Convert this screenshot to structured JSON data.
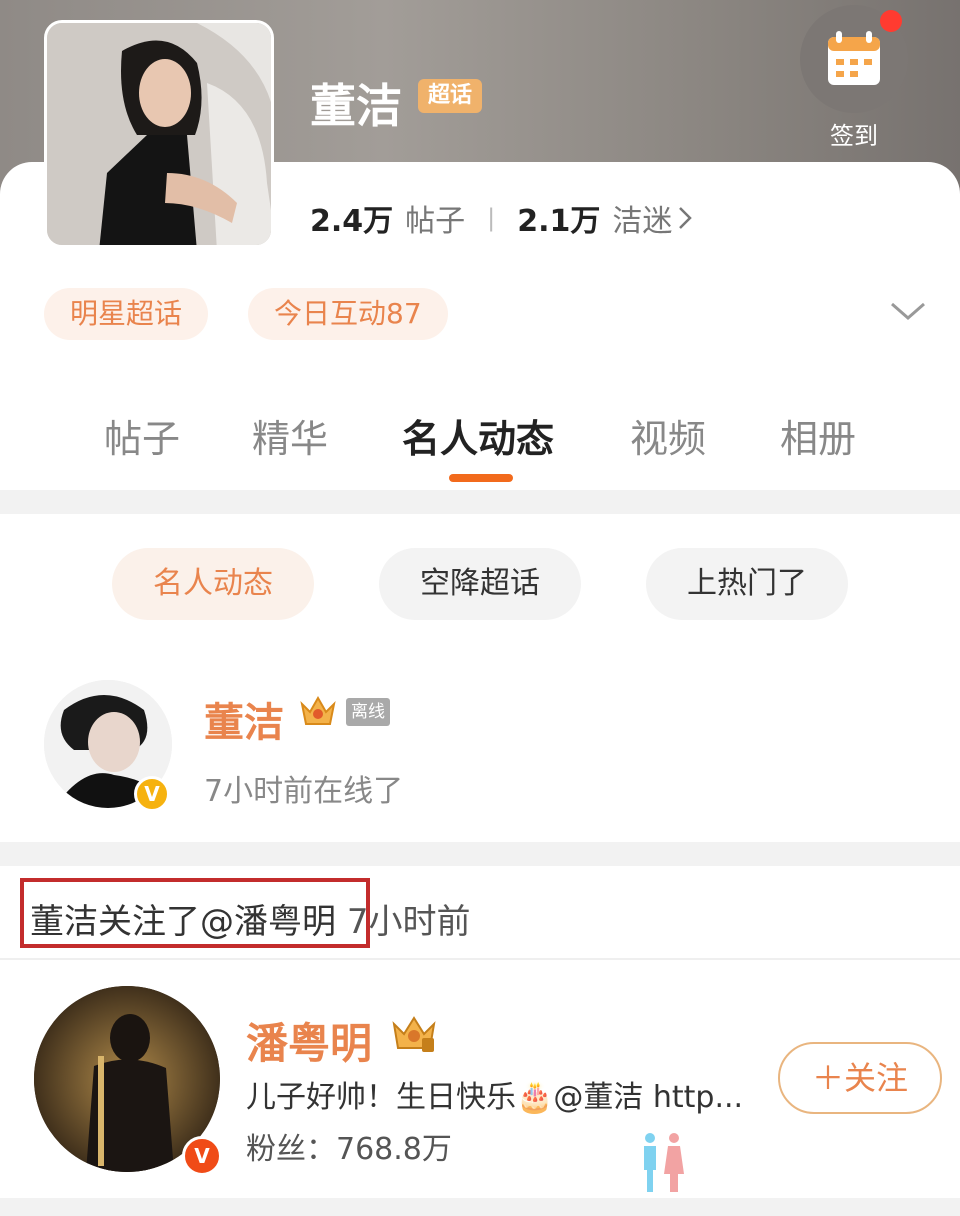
{
  "topic": {
    "title": "董洁",
    "tag": "超话",
    "checkin_label": "签到",
    "posts_count": "2.4万",
    "posts_label": "帖子",
    "fans_count": "2.1万",
    "fans_label": "洁迷",
    "chips": [
      "明星超话",
      "今日互动87"
    ]
  },
  "tabs": [
    "帖子",
    "精华",
    "名人动态",
    "视频",
    "相册"
  ],
  "active_tab": "名人动态",
  "filters": [
    "名人动态",
    "空降超话",
    "上热门了"
  ],
  "celebrity": {
    "name": "董洁",
    "status_badge": "离线",
    "online_text": "7小时前在线了"
  },
  "activity": {
    "text": "董洁关注了@潘粤明",
    "time": "7小时前"
  },
  "followed_user": {
    "name": "潘粤明",
    "post_preview": "儿子好帅！生日快乐🎂@董洁 http...",
    "fans_text": "粉丝：768.8万",
    "follow_button": "＋关注"
  },
  "colors": {
    "accent_orange": "#e9844d",
    "tab_underline": "#f26a1c",
    "highlight_red": "#c32c2c",
    "verified_gold": "#f6b20f"
  },
  "icons": [
    "calendar-icon",
    "chevron-right-icon",
    "chevron-down-icon",
    "crown-icon",
    "verified-badge-icon",
    "watermark-icon"
  ]
}
